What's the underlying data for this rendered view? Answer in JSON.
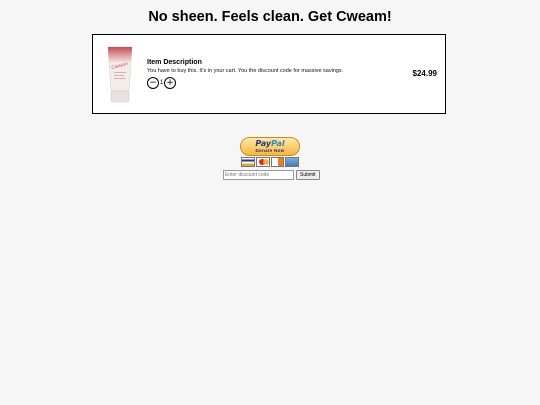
{
  "headline": "No sheen. Feels clean. Get Cweam!",
  "cart": {
    "item_title": "Item Description",
    "item_description": "You have to buy this. It's in your cart. You the discount code for massive savings.",
    "quantity": "1",
    "price": "$24.99",
    "decrease_symbol": "−",
    "increase_symbol": "+"
  },
  "product_image": {
    "brand_text": "Cweam",
    "tube_color": "#f3ece9",
    "cap_color": "#e7e2df",
    "band_color": "#d9777a"
  },
  "paypal": {
    "logo_pay": "Pay",
    "logo_pal": "Pal",
    "sub_label": "Donate Now",
    "accepted_cards": [
      "visa-icon",
      "mastercard-icon",
      "discover-icon",
      "amex-icon"
    ]
  },
  "discount": {
    "placeholder": "Enter discount code",
    "value": "",
    "submit_label": "Submit"
  }
}
